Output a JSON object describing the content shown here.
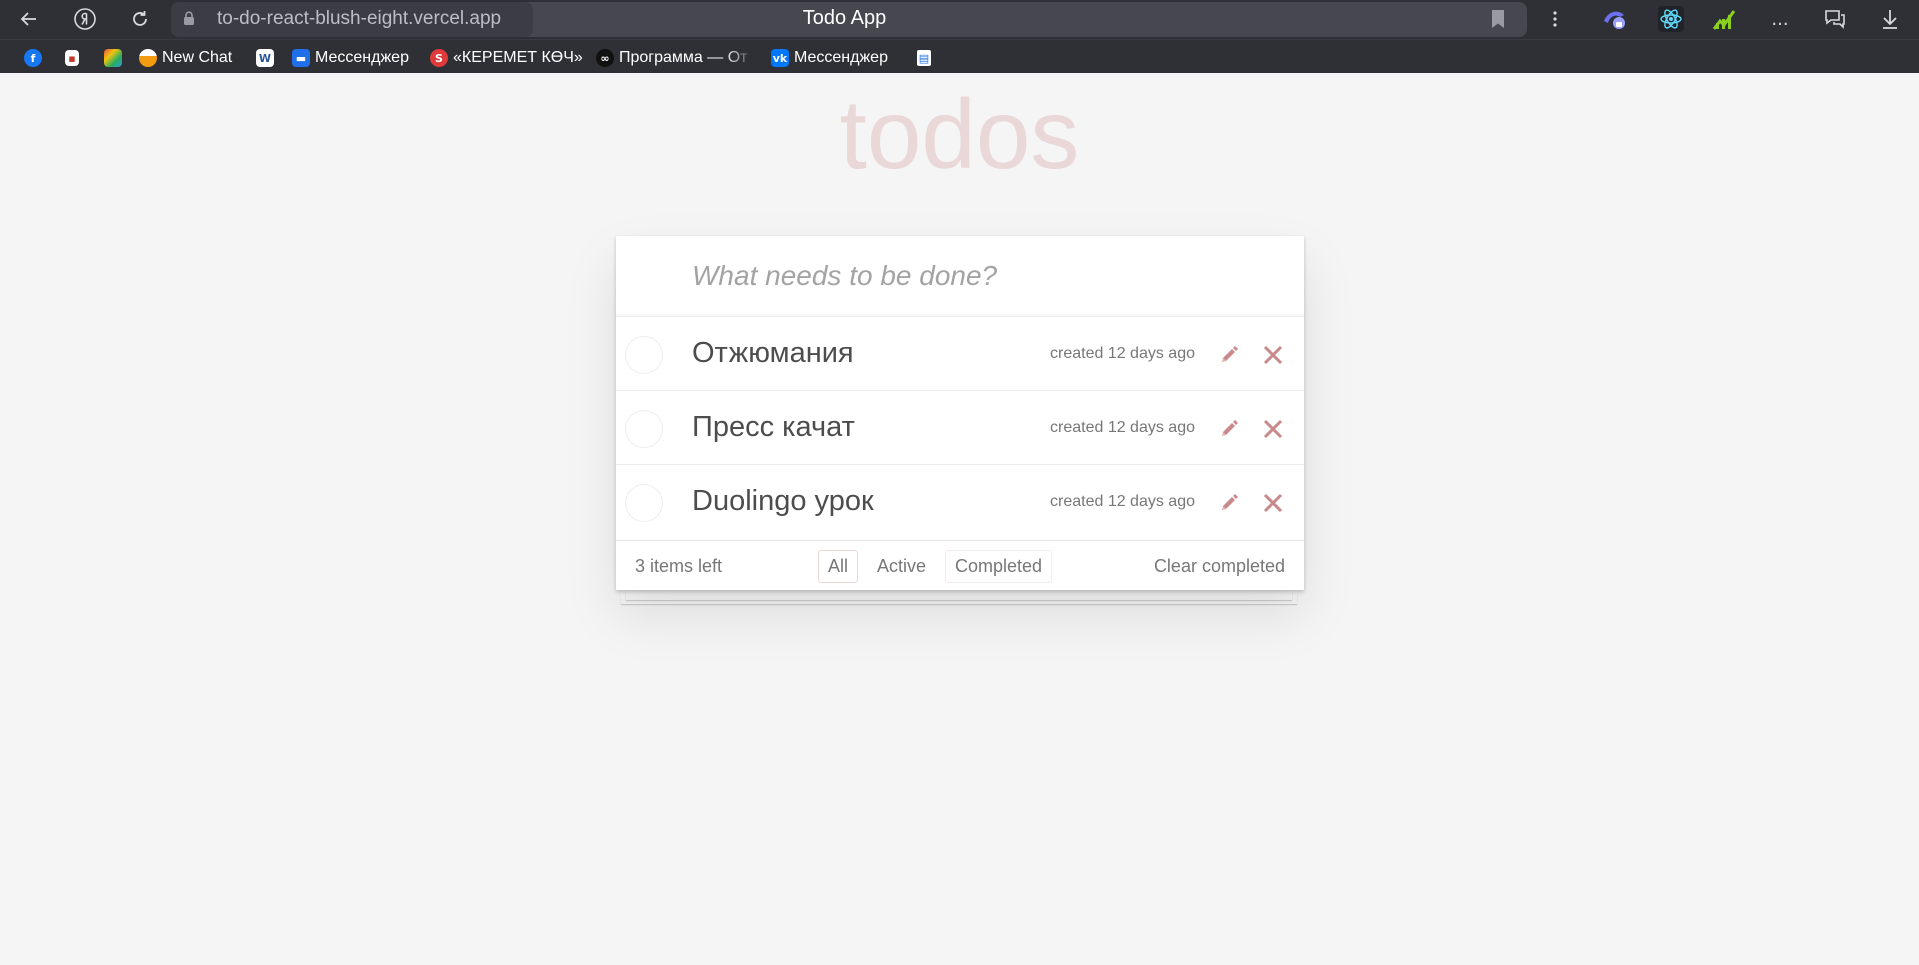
{
  "browser": {
    "url": "to-do-react-blush-eight.vercel.app",
    "tab_title": "Todo App",
    "icons": [
      "back-icon",
      "yandex-icon",
      "reload-icon",
      "lock-icon",
      "bookmark-icon",
      "more-icon",
      "extension-vpn-icon",
      "react-devtools-icon",
      "extension-chart-icon",
      "overflow-icon",
      "chat-icon",
      "download-icon"
    ],
    "overflow_label": "...",
    "bookmarks": [
      {
        "label": ""
      },
      {
        "label": ""
      },
      {
        "label": ""
      },
      {
        "label": "New Chat"
      },
      {
        "label": ""
      },
      {
        "label": "Мессенджер"
      },
      {
        "label": "«КЕРЕМЕТ КӨЧ»"
      },
      {
        "label": "Программа — От"
      },
      {
        "label": "Мессенджер"
      },
      {
        "label": ""
      }
    ]
  },
  "app": {
    "title": "todos",
    "new_todo_placeholder": "What needs to be done?",
    "todos": [
      {
        "label": "Отжюмания",
        "created": "created 12 days ago",
        "completed": false
      },
      {
        "label": "Пресс качат",
        "created": "created 12 days ago",
        "completed": false
      },
      {
        "label": "Duolingo урок",
        "created": "created 12 days ago",
        "completed": false
      }
    ],
    "footer": {
      "count": "3 items left",
      "filters": [
        {
          "label": "All",
          "selected": true
        },
        {
          "label": "Active",
          "selected": false
        },
        {
          "label": "Completed",
          "selected": false
        }
      ],
      "clear": "Clear completed"
    },
    "colors": {
      "title": "#ead7d7",
      "accent": "#af5b5e",
      "background": "#f5f5f5",
      "chrome": "#2f2f36"
    }
  }
}
